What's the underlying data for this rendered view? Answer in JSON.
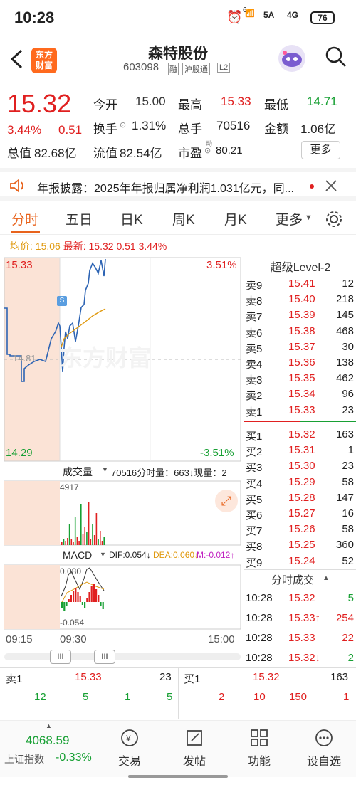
{
  "status": {
    "time": "10:28",
    "net": "6",
    "sig1": "5A",
    "sig2": "4G",
    "battery": "76"
  },
  "header": {
    "brand": "东方\n财富",
    "name": "森特股份",
    "code": "603098",
    "tag_rong": "融",
    "tag_hgt": "沪股通",
    "tag_l2": "L2"
  },
  "quote": {
    "price": "15.32",
    "pct": "3.44%",
    "chg": "0.51",
    "open_label": "今开",
    "open": "15.00",
    "high_label": "最高",
    "high": "15.33",
    "low_label": "最低",
    "low": "14.71",
    "turnover_label": "换手",
    "turnover": "1.31%",
    "volume_label": "总手",
    "volume": "70516",
    "amount_label": "金额",
    "amount": "1.06亿",
    "mcap_label": "总值",
    "mcap": "82.68亿",
    "float_label": "流值",
    "float": "82.54亿",
    "pe_label": "市盈",
    "pe_sup": "动",
    "pe": "80.21",
    "more": "更多"
  },
  "notice": {
    "text": "年报披露：2025年年报归属净利润1.031亿元，同..."
  },
  "tabs": [
    "分时",
    "五日",
    "日K",
    "周K",
    "月K",
    "更多"
  ],
  "avgline": {
    "avg_label": "均价:",
    "avg": "15.06",
    "last_label": "最新:",
    "last": "15.32",
    "chg": "0.51",
    "pct": "3.44%"
  },
  "chart": {
    "top_price": "15.33",
    "bottom_price": "14.29",
    "top_pct": "3.51%",
    "bottom_pct": "-3.51%",
    "mid_price": "14.81",
    "s_label": "S",
    "vol_label": "成交量",
    "vol_info": "70516分时量：663↓现量：2",
    "vol_max": "4917",
    "macd_label": "MACD",
    "dif": "DIF:0.054↓",
    "dea": "DEA:0.060↓",
    "m": "M:-0.012↑",
    "macd_top": "0.080",
    "macd_bot": "-0.054",
    "t_start": "09:15",
    "t_mid": "09:30",
    "t_end": "15:00",
    "watermark": "东方财富"
  },
  "orderbook": {
    "title": "超级Level-2",
    "asks": [
      [
        "卖9",
        "15.41",
        "12"
      ],
      [
        "卖8",
        "15.40",
        "218"
      ],
      [
        "卖7",
        "15.39",
        "145"
      ],
      [
        "卖6",
        "15.38",
        "468"
      ],
      [
        "卖5",
        "15.37",
        "30"
      ],
      [
        "卖4",
        "15.36",
        "138"
      ],
      [
        "卖3",
        "15.35",
        "462"
      ],
      [
        "卖2",
        "15.34",
        "96"
      ],
      [
        "卖1",
        "15.33",
        "23"
      ]
    ],
    "bids": [
      [
        "买1",
        "15.32",
        "163"
      ],
      [
        "买2",
        "15.31",
        "1"
      ],
      [
        "买3",
        "15.30",
        "23"
      ],
      [
        "买4",
        "15.29",
        "58"
      ],
      [
        "买5",
        "15.28",
        "147"
      ],
      [
        "买6",
        "15.27",
        "16"
      ],
      [
        "买7",
        "15.26",
        "58"
      ],
      [
        "买8",
        "15.25",
        "360"
      ],
      [
        "买9",
        "15.24",
        "52"
      ]
    ],
    "ticks_title": "分时成交",
    "ticks": [
      [
        "10:28",
        "15.32",
        "5"
      ],
      [
        "10:28",
        "15.33↑",
        "254"
      ],
      [
        "10:28",
        "15.33",
        "22"
      ],
      [
        "10:28",
        "15.32↓",
        "2"
      ]
    ]
  },
  "bottom": {
    "sell_label": "卖1",
    "sell_price": "15.33",
    "sell_vol": "23",
    "buy_label": "买1",
    "buy_price": "15.32",
    "buy_vol": "163",
    "sell_q": [
      "12",
      "5",
      "1",
      "5"
    ],
    "buy_q": [
      "2",
      "10",
      "150",
      "1"
    ]
  },
  "nav": {
    "index_val": "4068.59",
    "index_name": "上证指数",
    "index_pct": "-0.33%",
    "items": [
      "交易",
      "发帖",
      "功能",
      "设自选"
    ]
  }
}
